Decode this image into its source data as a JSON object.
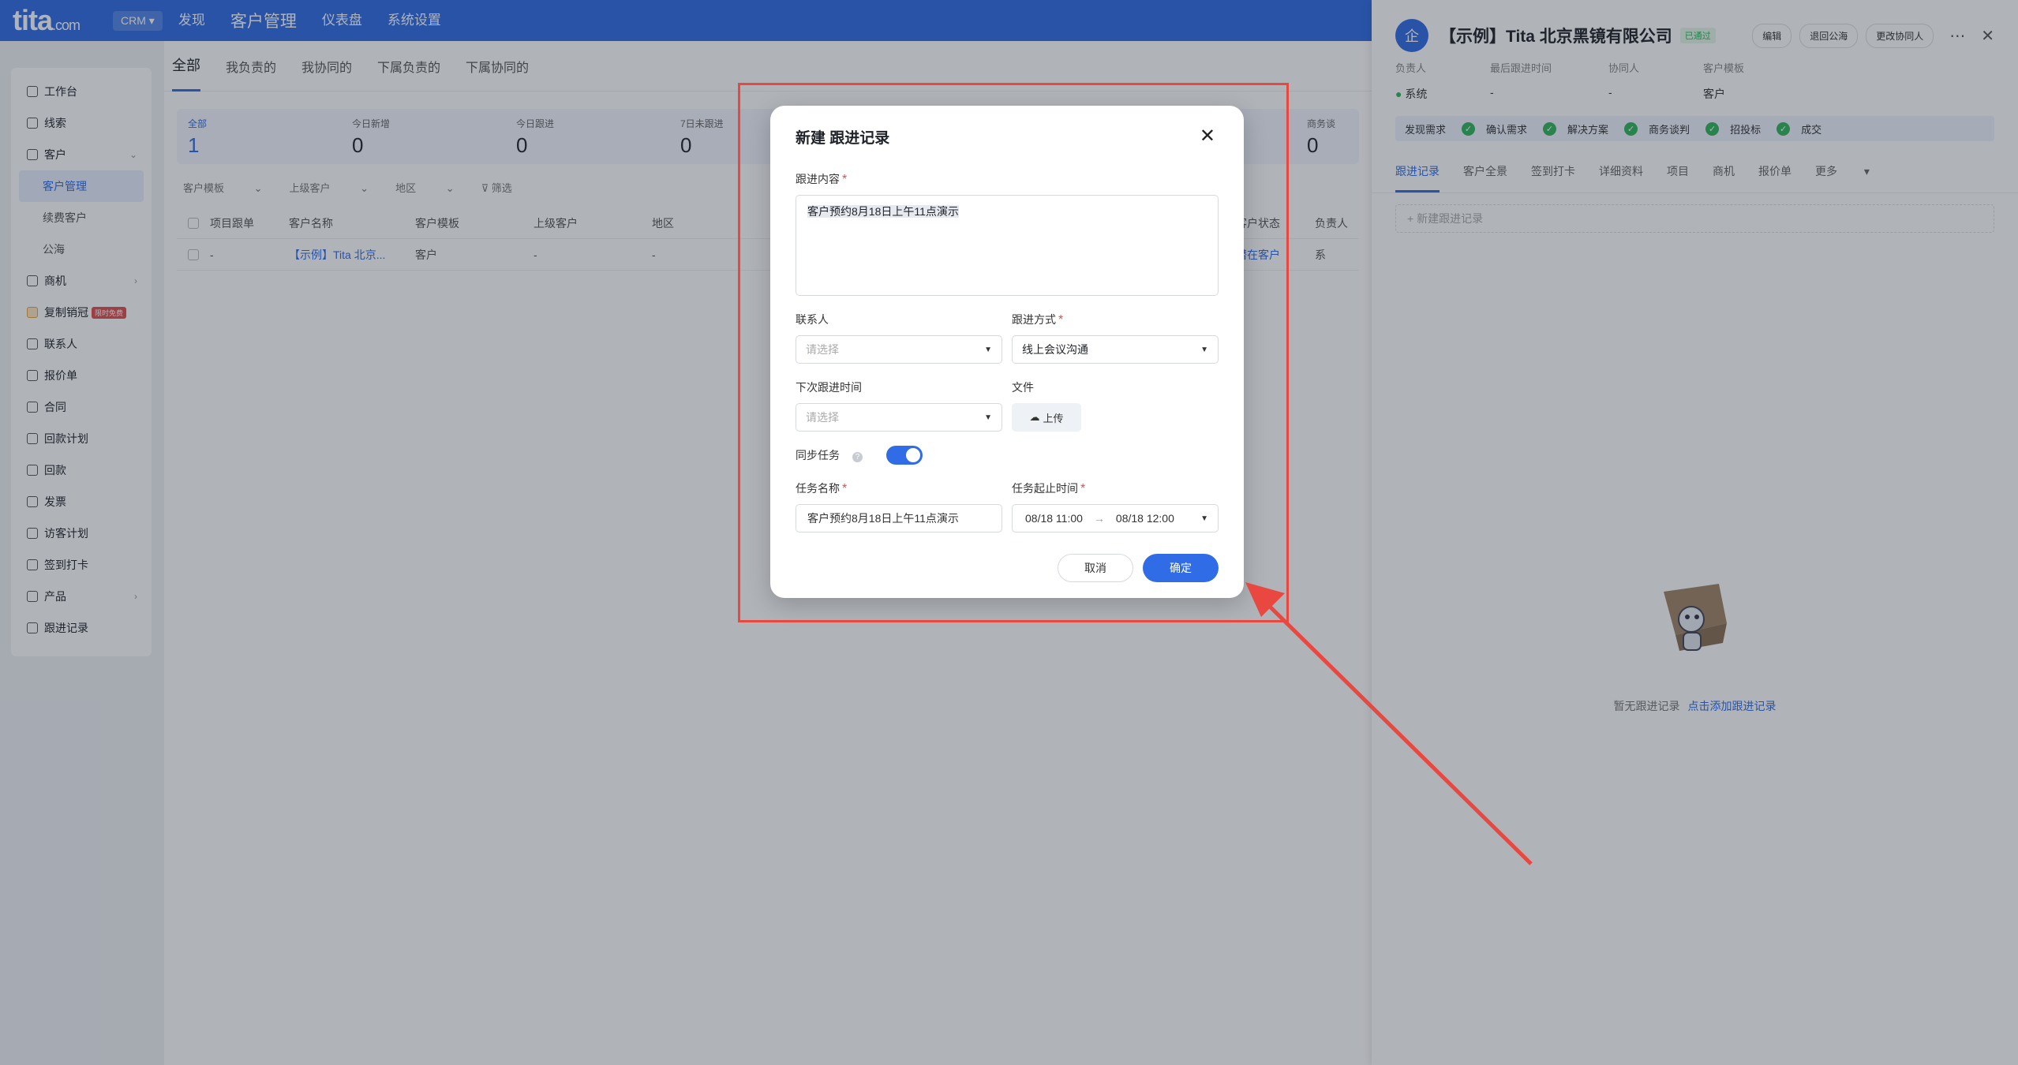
{
  "topbar": {
    "logo": "tita",
    "logo_suffix": ".com",
    "app_switch": "CRM",
    "nav": [
      "发现",
      "客户管理",
      "仪表盘",
      "系统设置"
    ],
    "active_nav": "客户管理"
  },
  "sidebar": {
    "items": [
      {
        "label": "工作台",
        "icon": "home-icon"
      },
      {
        "label": "线索",
        "icon": "leads-icon"
      },
      {
        "label": "客户",
        "icon": "customer-icon",
        "expandable": true
      },
      {
        "label": "客户管理",
        "sub": true,
        "active": true
      },
      {
        "label": "续费客户",
        "sub": true
      },
      {
        "label": "公海",
        "sub": true
      },
      {
        "label": "商机",
        "icon": "opportunity-icon",
        "expandable": true
      },
      {
        "label": "复制销冠",
        "icon": "crown-icon",
        "badge": "限时免费"
      },
      {
        "label": "联系人",
        "icon": "contact-icon"
      },
      {
        "label": "报价单",
        "icon": "quote-icon"
      },
      {
        "label": "合同",
        "icon": "contract-icon"
      },
      {
        "label": "回款计划",
        "icon": "plan-icon"
      },
      {
        "label": "回款",
        "icon": "payment-icon"
      },
      {
        "label": "发票",
        "icon": "invoice-icon"
      },
      {
        "label": "访客计划",
        "icon": "visit-icon"
      },
      {
        "label": "签到打卡",
        "icon": "checkin-icon"
      },
      {
        "label": "产品",
        "icon": "product-icon",
        "expandable": true
      },
      {
        "label": "跟进记录",
        "icon": "followup-icon"
      }
    ]
  },
  "main": {
    "tabs": [
      "全部",
      "我负责的",
      "我协同的",
      "下属负责的",
      "下属协同的"
    ],
    "stats": [
      {
        "label": "全部",
        "value": "1"
      },
      {
        "label": "今日新增",
        "value": "0"
      },
      {
        "label": "今日跟进",
        "value": "0"
      },
      {
        "label": "7日未跟进",
        "value": "0"
      }
    ],
    "stat_right": "0",
    "stat_right_label": "商务谈",
    "filters": [
      "客户模板",
      "上级客户",
      "地区",
      "筛选"
    ],
    "columns": [
      "项目跟单",
      "客户名称",
      "客户模板",
      "上级客户",
      "地区"
    ],
    "row": {
      "project": "-",
      "name": "【示例】Tita 北京...",
      "template": "客户",
      "parent": "-",
      "region": "-"
    },
    "col_status": "客户状态",
    "col_owner": "负责人",
    "status_val": "潜在客户",
    "owner_val": "系"
  },
  "drawer": {
    "avatar": "企",
    "title": "【示例】Tita 北京黑镜有限公司",
    "badge": "已通过",
    "actions": [
      "编辑",
      "退回公海",
      "更改协同人"
    ],
    "fields": [
      {
        "key": "负责人",
        "value": "系统"
      },
      {
        "key": "最后跟进时间",
        "value": "-"
      },
      {
        "key": "协同人",
        "value": "-"
      },
      {
        "key": "客户模板",
        "value": "客户"
      }
    ],
    "stages": [
      "发现需求",
      "确认需求",
      "解决方案",
      "商务谈判",
      "招投标",
      "成交"
    ],
    "tabs": [
      "跟进记录",
      "客户全景",
      "签到打卡",
      "详细资料",
      "项目",
      "商机",
      "报价单",
      "更多"
    ],
    "add_placeholder": "+ 新建跟进记录",
    "empty_text": "暂无跟进记录",
    "empty_link": "点击添加跟进记录"
  },
  "modal": {
    "title": "新建 跟进记录",
    "content_label": "跟进内容",
    "content_value": "客户预约8月18日上午11点演示",
    "contact_label": "联系人",
    "contact_placeholder": "请选择",
    "method_label": "跟进方式",
    "method_value": "线上会议沟通",
    "next_time_label": "下次跟进时间",
    "next_time_placeholder": "请选择",
    "file_label": "文件",
    "upload_label": "上传",
    "sync_label": "同步任务",
    "sync_on": true,
    "task_name_label": "任务名称",
    "task_name_value": "客户预约8月18日上午11点演示",
    "task_time_label": "任务起止时间",
    "task_start": "08/18 11:00",
    "task_end": "08/18 12:00",
    "cancel_label": "取消",
    "ok_label": "确定"
  },
  "colors": {
    "primary": "#2f6ce5",
    "annotation": "#e8483f",
    "success": "#2fb55b"
  }
}
